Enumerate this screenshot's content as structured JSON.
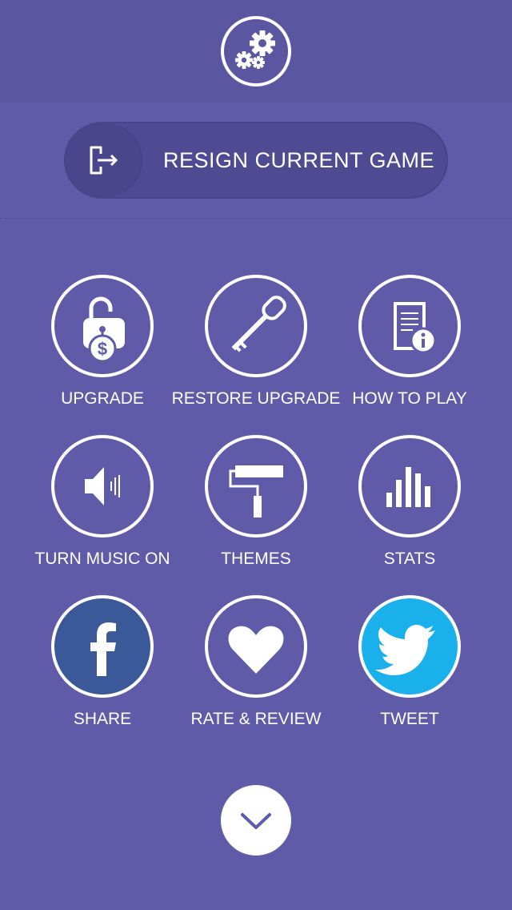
{
  "header": {
    "settings_icon": "gears-icon"
  },
  "resign": {
    "label": "RESIGN CURRENT GAME",
    "icon": "exit-door-icon"
  },
  "menu": {
    "items": [
      {
        "label": "UPGRADE",
        "icon": "padlock-dollar-icon"
      },
      {
        "label": "RESTORE UPGRADE",
        "icon": "key-icon"
      },
      {
        "label": "HOW TO PLAY",
        "icon": "document-info-icon"
      },
      {
        "label": "TURN MUSIC ON",
        "icon": "speaker-icon"
      },
      {
        "label": "THEMES",
        "icon": "paint-roller-icon"
      },
      {
        "label": "STATS",
        "icon": "bar-chart-icon"
      },
      {
        "label": "SHARE",
        "icon": "facebook-icon"
      },
      {
        "label": "RATE & REVIEW",
        "icon": "heart-icon"
      },
      {
        "label": "TWEET",
        "icon": "twitter-bird-icon"
      }
    ]
  },
  "footer": {
    "down_icon": "chevron-down-icon"
  },
  "colors": {
    "background": "#5f5ba8",
    "header": "#5a56a0",
    "resign_bg": "#4f4b92",
    "facebook": "#3b5998",
    "twitter": "#1ab0ec",
    "icon": "#ffffff"
  }
}
